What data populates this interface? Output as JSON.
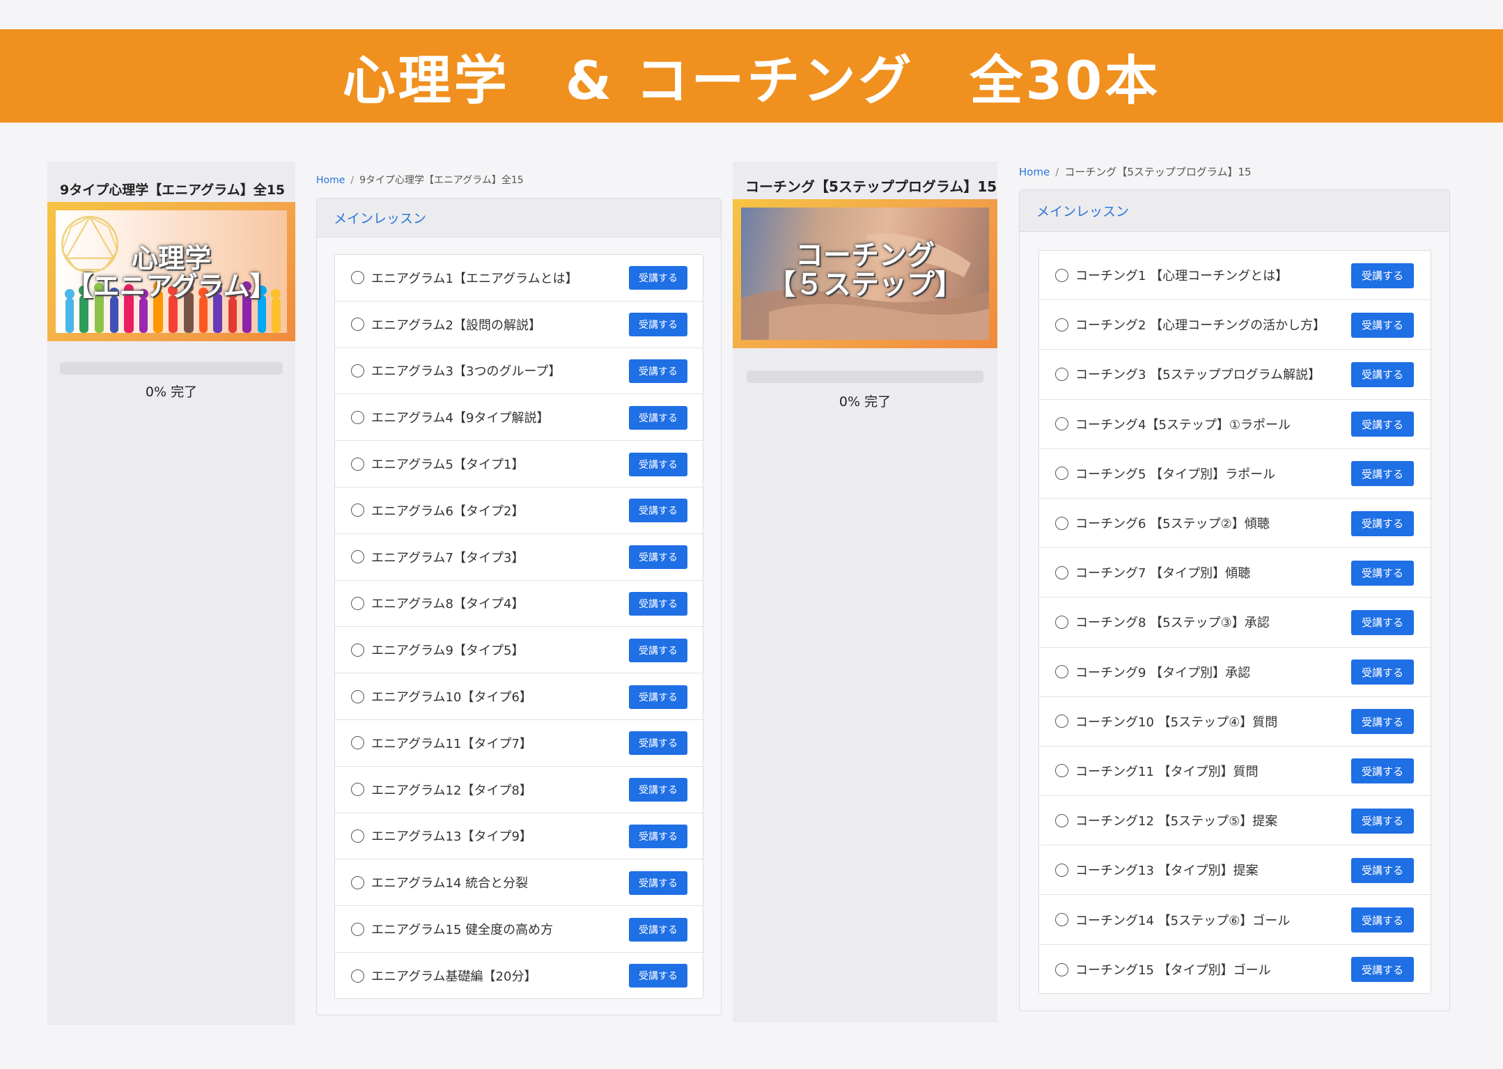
{
  "banner": {
    "title": "心理学　& コーチング　全30本"
  },
  "courses": [
    {
      "sidebar_title": "9タイプ心理学【エニアグラム】全15",
      "thumbnail_text": "心理学\n【エニアグラム】",
      "progress": 0,
      "progress_label": "0% 完了",
      "breadcrumb": {
        "home": "Home",
        "separator": "/",
        "current": "9タイプ心理学【エニアグラム】全15"
      },
      "section_title": "メインレッスン",
      "button_label": "受講する",
      "lessons": [
        "エニアグラム1【エニアグラムとは】",
        "エニアグラム2【設問の解説】",
        "エニアグラム3【3つのグループ】",
        "エニアグラム4【9タイプ解説】",
        "エニアグラム5【タイプ1】",
        "エニアグラム6【タイプ2】",
        "エニアグラム7【タイプ3】",
        "エニアグラム8【タイプ4】",
        "エニアグラム9【タイプ5】",
        "エニアグラム10【タイプ6】",
        "エニアグラム11【タイプ7】",
        "エニアグラム12【タイプ8】",
        "エニアグラム13【タイプ9】",
        "エニアグラム14 統合と分裂",
        "エニアグラム15 健全度の高め方",
        "エニアグラム基礎編【20分】"
      ]
    },
    {
      "sidebar_title": "コーチング【5ステッププログラム】15",
      "thumbnail_text": "コーチング\n【５ステップ】",
      "progress": 0,
      "progress_label": "0% 完了",
      "breadcrumb": {
        "home": "Home",
        "separator": "/",
        "current": "コーチング【5ステッププログラム】15"
      },
      "section_title": "メインレッスン",
      "button_label": "受講する",
      "lessons": [
        "コーチング1 【心理コーチングとは】",
        "コーチング2 【心理コーチングの活かし方】",
        "コーチング3 【5ステッププログラム解説】",
        "コーチング4【5ステップ】①ラポール",
        "コーチング5 【タイプ別】ラポール",
        "コーチング6 【5ステップ②】傾聴",
        "コーチング7 【タイプ別】傾聴",
        "コーチング8 【5ステップ③】承認",
        "コーチング9 【タイプ別】承認",
        "コーチング10 【5ステップ④】質問",
        "コーチング11 【タイプ別】質問",
        "コーチング12 【5ステップ⑤】提案",
        "コーチング13 【タイプ別】提案",
        "コーチング14 【5ステップ⑥】ゴール",
        "コーチング15 【タイプ別】ゴール"
      ]
    }
  ],
  "colors": {
    "banner": "#f0901f",
    "link": "#2b74d9",
    "button": "#1f6fe5",
    "thumb_frame_top": "#f6c443",
    "thumb_frame_bottom": "#f08a3c"
  },
  "icons": {
    "lesson_status": "radio-circle-icon",
    "enneagram": "enneagram-symbol-icon"
  }
}
